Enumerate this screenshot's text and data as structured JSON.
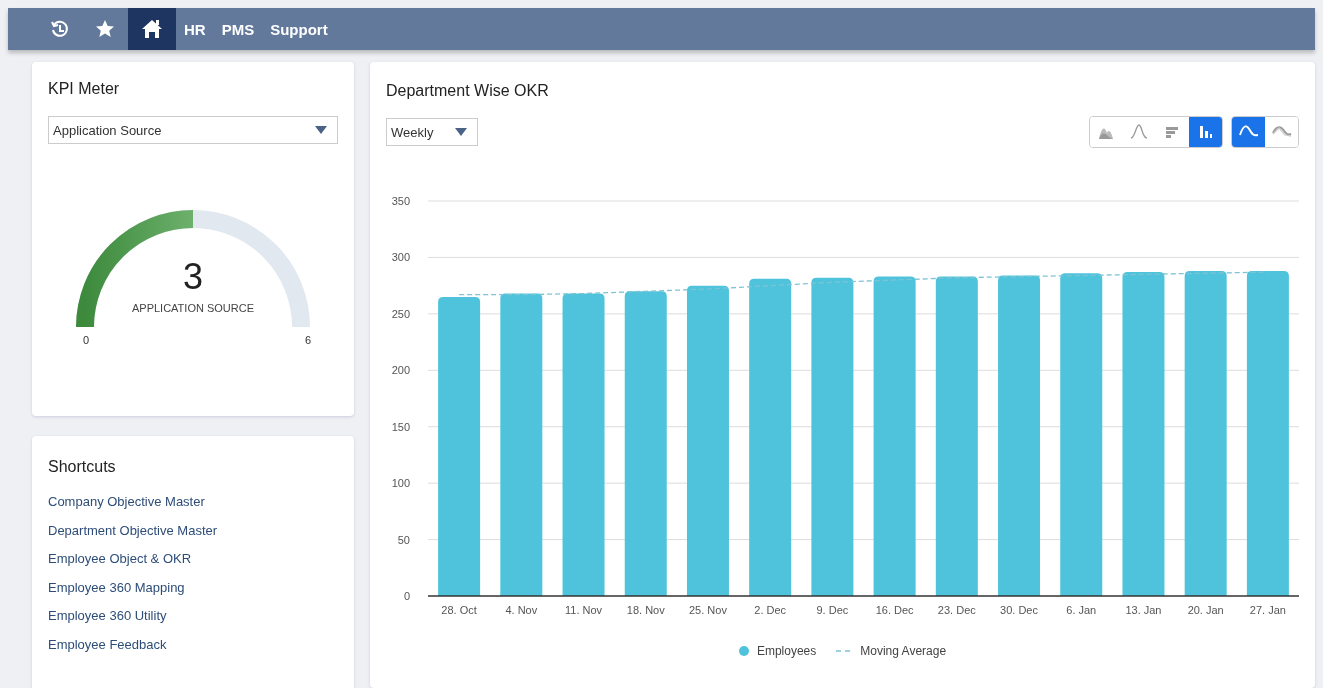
{
  "top_bar": {
    "items": [
      {
        "kind": "history",
        "selected": false
      },
      {
        "kind": "favorites",
        "selected": false
      },
      {
        "kind": "home",
        "selected": true
      },
      {
        "kind": "text",
        "label": "HR",
        "selected": false
      },
      {
        "kind": "text",
        "label": "PMS",
        "selected": false
      },
      {
        "kind": "text",
        "label": "Support",
        "selected": false
      }
    ]
  },
  "kpi_meter": {
    "title": "KPI Meter",
    "dropdown": {
      "value": "Application Source"
    },
    "gauge": {
      "value": "3",
      "caption": "APPLICATION SOURCE",
      "min": "0",
      "max": "6",
      "level": 0.5
    }
  },
  "shortcuts": {
    "title": "Shortcuts",
    "links": [
      "Company Objective Master",
      "Department Objective Master",
      "Employee Object & OKR",
      "Employee 360 Mapping",
      "Employee 360 Utility",
      "Employee Feedback"
    ]
  },
  "okr": {
    "title": "Department Wise OKR",
    "period": {
      "value": "Weekly"
    },
    "chart_types": [
      {
        "kind": "area",
        "selected": false
      },
      {
        "kind": "line",
        "selected": false
      },
      {
        "kind": "hbar",
        "selected": false
      },
      {
        "kind": "column",
        "selected": true
      }
    ],
    "curve_types": [
      {
        "kind": "smooth",
        "selected": true
      },
      {
        "kind": "straight",
        "selected": false
      }
    ],
    "chart_data": {
      "type": "bar",
      "categories": [
        "28. Oct",
        "4. Nov",
        "11. Nov",
        "18. Nov",
        "25. Nov",
        "2. Dec",
        "9. Dec",
        "16. Dec",
        "23. Dec",
        "30. Dec",
        "6. Jan",
        "13. Jan",
        "20. Jan",
        "27. Jan"
      ],
      "ylim": [
        0,
        350
      ],
      "grid": true,
      "yticks": [
        0,
        50,
        100,
        150,
        200,
        250,
        300,
        350
      ],
      "series": [
        {
          "name": "Employees",
          "color": "#4fc3db",
          "values": [
            265,
            268,
            268,
            270,
            275,
            281,
            282,
            283,
            283,
            284,
            286,
            287,
            288,
            288
          ]
        },
        {
          "name": "Moving Average",
          "type": "line",
          "line_style": "dashed",
          "color": "#7cc4d4",
          "values": [
            267,
            267,
            268,
            270,
            272,
            275,
            278,
            280,
            282,
            283,
            284,
            285,
            286,
            287
          ]
        }
      ]
    }
  }
}
